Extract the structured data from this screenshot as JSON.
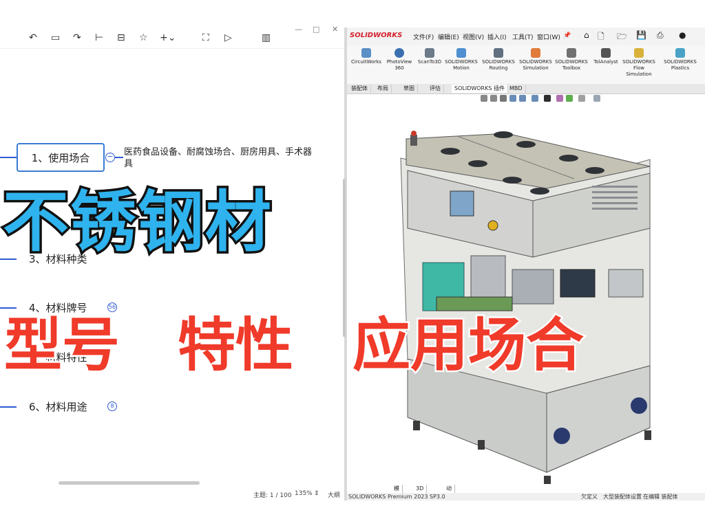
{
  "mindmap": {
    "toolbar_icons": [
      "undo-icon",
      "insert-node-icon",
      "redo-icon",
      "sibling-node-icon",
      "summary-icon",
      "star-icon",
      "add-icon",
      "frame-icon",
      "present-icon",
      "layout-icon"
    ],
    "nodes": [
      {
        "label": "1、使用场合"
      },
      {
        "label": "3、材料种类"
      },
      {
        "label": "4、材料牌号",
        "badge": "56"
      },
      {
        "label": "5、材料特性"
      },
      {
        "label": "6、材料用途",
        "badge": "8"
      }
    ],
    "leaf_text": "医药食品设备、耐腐蚀场合、厨房用具、手术器具",
    "status": {
      "topic": "主题: 1 / 100",
      "zoom": "135%",
      "outline": "大纲"
    }
  },
  "solidworks": {
    "logo": "SOLIDWORKS",
    "menus": [
      "文件(F)",
      "编辑(E)",
      "视图(V)",
      "插入(I)",
      "工具(T)",
      "窗口(W)"
    ],
    "commands": [
      {
        "label": "CircuitWorks"
      },
      {
        "label": "PhotoView 360"
      },
      {
        "label": "ScanTo3D"
      },
      {
        "label": "SOLIDWORKS Motion"
      },
      {
        "label": "SOLIDWORKS Routing"
      },
      {
        "label": "SOLIDWORKS Simulation"
      },
      {
        "label": "SOLIDWORKS Toolbox"
      },
      {
        "label": "TolAnalyst"
      },
      {
        "label": "SOLIDWORKS Flow Simulation"
      },
      {
        "label": "SOLIDWORKS Plastics"
      }
    ],
    "tabs": [
      "装配体",
      "布局",
      "草图",
      "评估",
      "SOLIDWORKS 插件",
      "MBD"
    ],
    "active_tab": "SOLIDWORKS 插件",
    "bottom_tabs": [
      "模型",
      "3D 视图",
      "动画1"
    ],
    "status_left": "SOLIDWORKS Premium 2023 SP3.0",
    "status_right": [
      "欠定义",
      "在编辑 装配体",
      "大型装配体设置"
    ]
  },
  "overlay": {
    "headline": "不锈钢材",
    "subtitle_1": "型号",
    "subtitle_2": "特性",
    "subtitle_3": "应用场合"
  },
  "colors": {
    "headline_fill": "#2fb3ee",
    "subtitle_fill": "#f03a2a",
    "node_border": "#3a7bd5",
    "connector": "#2f5bd3"
  }
}
